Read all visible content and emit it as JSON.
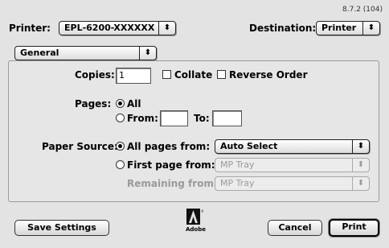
{
  "header": {
    "version": "8.7.2 (104)",
    "printer_label": "Printer:",
    "printer_value": "EPL-6200-XXXXXX",
    "destination_label": "Destination:",
    "destination_value": "Printer"
  },
  "panel_menu": {
    "value": "General"
  },
  "copies": {
    "label": "Copies:",
    "value": "1",
    "collate_label": "Collate",
    "collate_checked": false,
    "reverse_label": "Reverse Order",
    "reverse_checked": false
  },
  "pages": {
    "label": "Pages:",
    "all_label": "All",
    "from_label": "From:",
    "to_label": "To:",
    "from_value": "",
    "to_value": ""
  },
  "paper_source": {
    "label": "Paper Source:",
    "all_pages_label": "All pages from:",
    "all_pages_value": "Auto Select",
    "first_page_label": "First page from:",
    "first_page_value": "MP Tray",
    "remaining_label": "Remaining from:",
    "remaining_value": "MP Tray"
  },
  "footer": {
    "save_label": "Save Settings",
    "cancel_label": "Cancel",
    "print_label": "Print",
    "logo_text": "Adobe"
  }
}
